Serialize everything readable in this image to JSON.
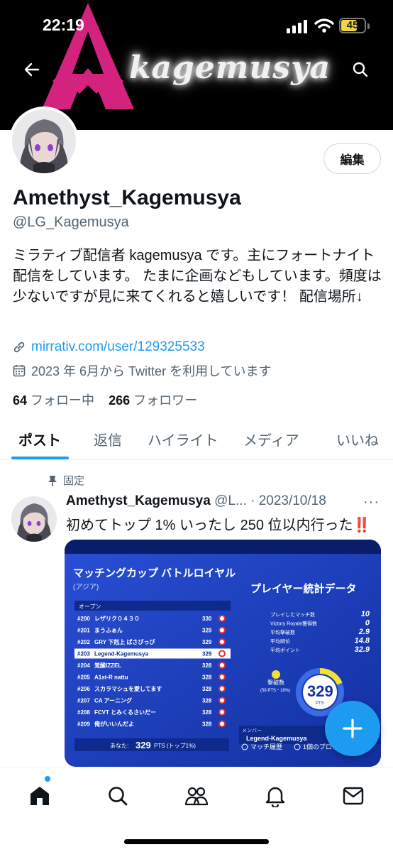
{
  "status_bar": {
    "time": "22:19",
    "battery": "45"
  },
  "banner": {
    "brand_text": "kagemusya",
    "brand_color": "#d4237f"
  },
  "profile": {
    "display_name": "Amethyst_Kagemusya",
    "handle": "@LG_Kagemusya",
    "edit_label": "編集",
    "bio": "ミラティブ配信者 kagemusya です。主にフォートナイト配信をしています。 たまに企画などもしています。頻度は少ないですが見に来てくれると嬉しいです！ 配信場所↓",
    "link": "mirrativ.com/user/129325533",
    "joined": "2023 年 6月から Twitter を利用しています",
    "following_count": "64",
    "following_label": "フォロー中",
    "followers_count": "266",
    "followers_label": "フォロワー"
  },
  "tabs": [
    {
      "label": "ポスト",
      "active": true
    },
    {
      "label": "返信",
      "active": false
    },
    {
      "label": "ハイライト",
      "active": false
    },
    {
      "label": "メディア",
      "active": false
    },
    {
      "label": "いいね",
      "active": false
    }
  ],
  "pinned_post": {
    "pinned_label": "固定",
    "author": "Amethyst_Kagemusya",
    "handle_truncated": "@L...",
    "separator": "·",
    "date": "2023/10/18",
    "text": "初めてトップ 1% いったし 250 位以内行った",
    "emoji": "‼️",
    "media": {
      "title": "マッチングカップ バトルロイヤル",
      "region": "(アジア)",
      "section_label": "オープン",
      "stats_title": "プレイヤー統計データ",
      "leaderboard": [
        {
          "rank": "200",
          "name": "レザリク０４３０",
          "pts": "330"
        },
        {
          "rank": "201",
          "name": "まうふぁん",
          "pts": "329"
        },
        {
          "rank": "202",
          "name": "GRY 下剋上 ばさぴっぴ",
          "pts": "329"
        },
        {
          "rank": "203",
          "name": "Legend-Kagemusya",
          "pts": "329"
        },
        {
          "rank": "204",
          "name": "覚醒IZZEL",
          "pts": "328"
        },
        {
          "rank": "205",
          "name": "A1st-R nattu",
          "pts": "328"
        },
        {
          "rank": "206",
          "name": "スカラマシュを愛してます",
          "pts": "328"
        },
        {
          "rank": "207",
          "name": "CA アーニング",
          "pts": "328"
        },
        {
          "rank": "208",
          "name": "FCVT とみくるさいだー",
          "pts": "328"
        },
        {
          "rank": "209",
          "name": "俺がいいんだよ",
          "pts": "328"
        }
      ],
      "stats": [
        {
          "label": "プレイしたマッチ数",
          "value": "10"
        },
        {
          "label": "Victory Royale獲得数",
          "value": "0"
        },
        {
          "label": "平均撃破数",
          "value": "2.9"
        },
        {
          "label": "平均順位",
          "value": "14.8"
        },
        {
          "label": "平均ポイント",
          "value": "32.9"
        }
      ],
      "eliminations_label": "撃破数",
      "eliminations_sub": "(58 PTS・18%)",
      "score": "329",
      "score_unit": "PTS",
      "member_label": "メンバー",
      "member_name": "Legend-Kagemusya",
      "you_label": "あなた:",
      "you_score": "329",
      "you_pts": "PTS",
      "you_top": "(トップ1%)",
      "history_btn": "マッチ履歴",
      "pro_btn": "1個のプロフ"
    }
  },
  "fab": {
    "icon": "plus-icon"
  },
  "bottom_nav": [
    "home-icon",
    "search-icon",
    "communities-icon",
    "notifications-icon",
    "messages-icon"
  ]
}
